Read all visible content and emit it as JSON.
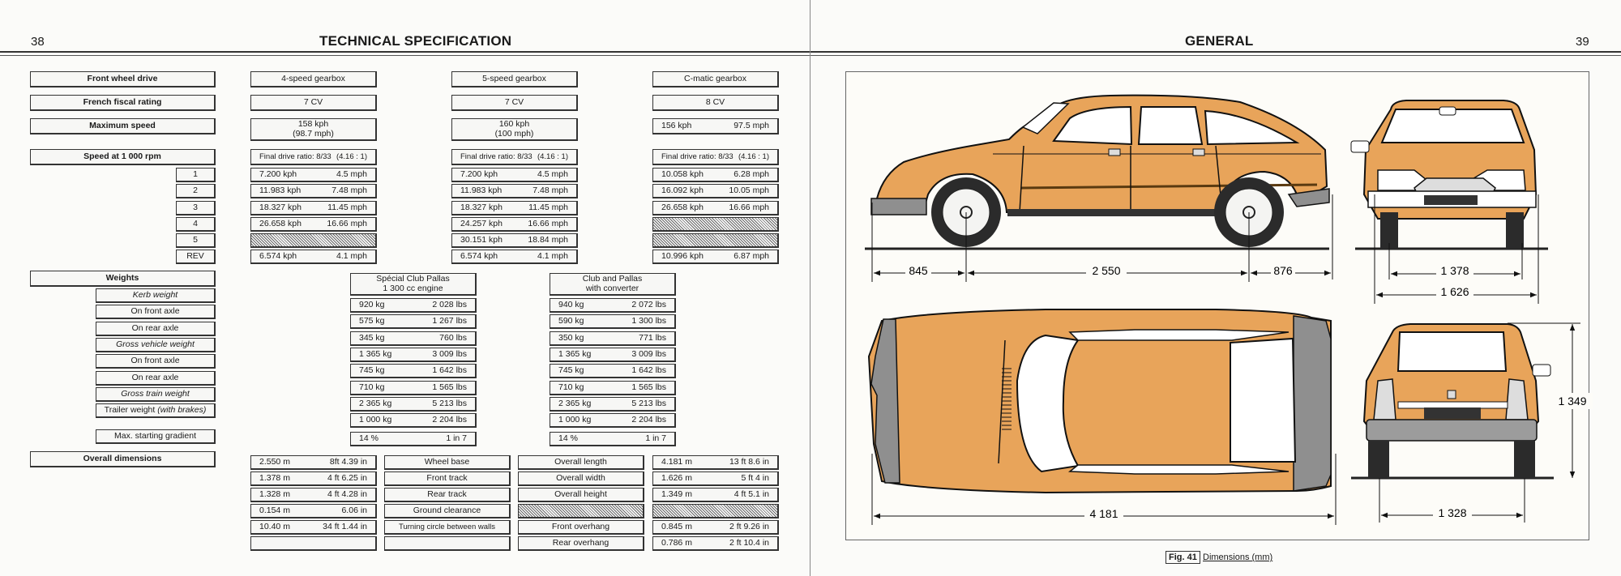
{
  "left_page": {
    "page_number": "38",
    "title": "TECHNICAL SPECIFICATION",
    "labels": {
      "front_wheel_drive": "Front wheel drive",
      "fiscal_rating": "French fiscal rating",
      "max_speed": "Maximum speed",
      "speed_at_1000": "Speed at 1 000 rpm",
      "gears": [
        "1",
        "2",
        "3",
        "4",
        "5",
        "REV"
      ],
      "weights": "Weights",
      "weight_rows": [
        {
          "label": "Kerb weight",
          "italic": true
        },
        {
          "label": "On front axle",
          "italic": false
        },
        {
          "label": "On rear axle",
          "italic": false
        },
        {
          "label": "Gross vehicle weight",
          "italic": true
        },
        {
          "label": "On front axle",
          "italic": false
        },
        {
          "label": "On rear axle",
          "italic": false
        },
        {
          "label": "Gross train weight",
          "italic": true
        },
        {
          "label": "Trailer weight",
          "suffix": "(with brakes)"
        }
      ],
      "max_gradient": "Max. starting gradient",
      "overall_dimensions": "Overall dimensions"
    },
    "gearboxes": [
      {
        "name": "4-speed gearbox",
        "fiscal": "7 CV",
        "max_speed": [
          "158 kph",
          "(98.7 mph)"
        ],
        "final_drive": [
          "Final drive ratio: 8/33",
          "(4.16 : 1)"
        ],
        "gears": [
          [
            "7.200 kph",
            "4.5 mph"
          ],
          [
            "11.983 kph",
            "7.48 mph"
          ],
          [
            "18.327 kph",
            "11.45 mph"
          ],
          [
            "26.658 kph",
            "16.66 mph"
          ],
          null,
          [
            "6.574 kph",
            "4.1  mph"
          ]
        ]
      },
      {
        "name": "5-speed gearbox",
        "fiscal": "7 CV",
        "max_speed": [
          "160 kph",
          "(100 mph)"
        ],
        "final_drive": [
          "Final drive ratio: 8/33",
          "(4.16 : 1)"
        ],
        "gears": [
          [
            "7.200 kph",
            "4.5  mph"
          ],
          [
            "11.983 kph",
            "7.48 mph"
          ],
          [
            "18.327 kph",
            "11.45 mph"
          ],
          [
            "24.257 kph",
            "16.66 mph"
          ],
          [
            "30.151 kph",
            "18.84 mph"
          ],
          [
            "6.574 kph",
            "4.1  mph"
          ]
        ]
      },
      {
        "name": "C-matic gearbox",
        "fiscal": "8 CV",
        "max_speed": [
          "156 kph",
          "97.5 mph"
        ],
        "final_drive": [
          "Final drive ratio: 8/33",
          "(4.16 : 1)"
        ],
        "gears": [
          [
            "10.058 kph",
            "6.28 mph"
          ],
          [
            "16.092 kph",
            "10.05 mph"
          ],
          [
            "26.658 kph",
            "16.66 mph"
          ],
          null,
          null,
          [
            "10.996 kph",
            "6.87 mph"
          ]
        ]
      }
    ],
    "weight_models": [
      {
        "name": [
          "Spécial Club Pallas",
          "1 300 cc engine"
        ],
        "values": [
          [
            "920 kg",
            "2 028 lbs"
          ],
          [
            "575 kg",
            "1 267 lbs"
          ],
          [
            "345 kg",
            "760 lbs"
          ],
          [
            "1 365 kg",
            "3 009 lbs"
          ],
          [
            "745 kg",
            "1 642 lbs"
          ],
          [
            "710 kg",
            "1 565 lbs"
          ],
          [
            "2 365 kg",
            "5 213 lbs"
          ],
          [
            "1 000 kg",
            "2 204 lbs"
          ]
        ],
        "gradient": [
          "14 %",
          "1 in 7"
        ]
      },
      {
        "name": [
          "Club and Pallas",
          "with converter"
        ],
        "values": [
          [
            "940 kg",
            "2 072 lbs"
          ],
          [
            "590 kg",
            "1 300 lbs"
          ],
          [
            "350 kg",
            "771 lbs"
          ],
          [
            "1 365 kg",
            "3 009 lbs"
          ],
          [
            "745 kg",
            "1 642 lbs"
          ],
          [
            "710 kg",
            "1 565 lbs"
          ],
          [
            "2 365 kg",
            "5 213 lbs"
          ],
          [
            "1 000 kg",
            "2 204 lbs"
          ]
        ],
        "gradient": [
          "14 %",
          "1 in 7"
        ]
      }
    ],
    "dimensions_left": [
      {
        "value": [
          "2.550 m",
          "8ft 4.39 in"
        ],
        "label": "Wheel base"
      },
      {
        "value": [
          "1.378 m",
          "4 ft 6.25 in"
        ],
        "label": "Front track"
      },
      {
        "value": [
          "1.328 m",
          "4 ft 4.28 in"
        ],
        "label": "Rear track"
      },
      {
        "value": [
          "0.154 m",
          "6.06 in"
        ],
        "label": "Ground clearance"
      },
      {
        "value": [
          "10.40 m",
          "34 ft 1.44 in"
        ],
        "label": "Turning circle between walls"
      },
      {
        "value": null,
        "label": ""
      }
    ],
    "dimensions_right": [
      {
        "label": "Overall length",
        "value": [
          "4.181 m",
          "13 ft 8.6 in"
        ]
      },
      {
        "label": "Overall width",
        "value": [
          "1.626 m",
          "5 ft 4 in"
        ]
      },
      {
        "label": "Overall height",
        "value": [
          "1.349 m",
          "4 ft 5.1 in"
        ]
      },
      {
        "label": null,
        "value": null
      },
      {
        "label": "Front overhang",
        "value": [
          "0.845 m",
          "2 ft 9.26 in"
        ]
      },
      {
        "label": "Rear overhang",
        "value": [
          "0.786 m",
          "2 ft 10.4 in"
        ]
      }
    ]
  },
  "right_page": {
    "page_number": "39",
    "title": "GENERAL",
    "figure": {
      "number": "Fig. 41",
      "caption": "Dimensions (mm)",
      "car_color": "#e8a45a",
      "side_view": {
        "front_overhang": "845",
        "wheelbase": "2 550",
        "rear_overhang": "876"
      },
      "front_view": {
        "front_track": "1 378",
        "overall_width": "1 626"
      },
      "top_view": {
        "overall_length": "4 181"
      },
      "rear_view": {
        "overall_height": "1 349",
        "rear_track": "1 328"
      }
    }
  }
}
